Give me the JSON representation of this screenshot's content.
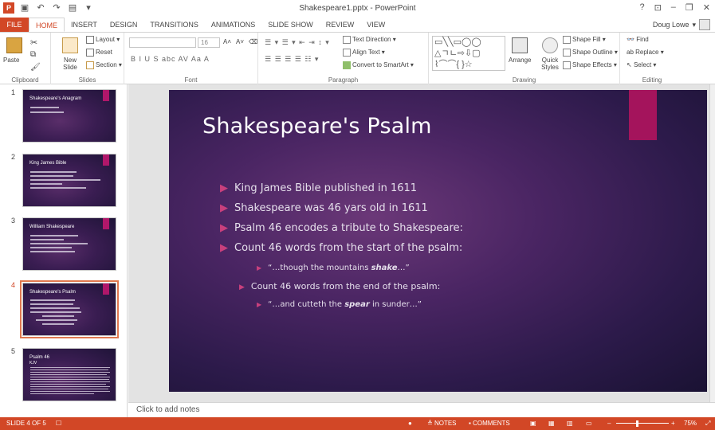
{
  "window": {
    "title": "Shakespeare1.pptx - PowerPoint",
    "help": "?",
    "user": "Doug Lowe"
  },
  "tabs": [
    "FILE",
    "HOME",
    "INSERT",
    "DESIGN",
    "TRANSITIONS",
    "ANIMATIONS",
    "SLIDE SHOW",
    "REVIEW",
    "VIEW"
  ],
  "ribbon": {
    "clipboard": {
      "label": "Clipboard",
      "paste": "Paste"
    },
    "slides": {
      "label": "Slides",
      "new_slide": "New Slide",
      "layout": "Layout",
      "reset": "Reset",
      "section": "Section"
    },
    "font": {
      "label": "Font",
      "size": "16",
      "format_row": "B  I  U  S  abc  AV  Aa  A"
    },
    "paragraph": {
      "label": "Paragraph",
      "text_direction": "Text Direction",
      "align_text": "Align Text",
      "smartart": "Convert to SmartArt"
    },
    "drawing": {
      "label": "Drawing",
      "arrange": "Arrange",
      "quick_styles": "Quick Styles",
      "shape_fill": "Shape Fill",
      "shape_outline": "Shape Outline",
      "shape_effects": "Shape Effects"
    },
    "editing": {
      "label": "Editing",
      "find": "Find",
      "replace": "Replace",
      "select": "Select"
    }
  },
  "thumbnails": [
    {
      "num": "1",
      "title": "Shakespeare's Anagram",
      "lines": 2
    },
    {
      "num": "2",
      "title": "King James Bible",
      "lines": 5
    },
    {
      "num": "3",
      "title": "William Shakespeare",
      "lines": 5
    },
    {
      "num": "4",
      "title": "Shakespeare's Psalm",
      "lines": 7
    },
    {
      "num": "5",
      "title": "Psalm 46",
      "subtitle": "KJV",
      "lines": 12
    }
  ],
  "slide": {
    "title": "Shakespeare's Psalm",
    "bullets": [
      {
        "text": "King James Bible published in 1611"
      },
      {
        "text": "Shakespeare was 46 yars old in 1611"
      },
      {
        "text": "Psalm 46 encodes a tribute to Shakespeare:"
      },
      {
        "text": "Count 46 words from the start of the psalm:"
      },
      {
        "pre": "“…though the mountains ",
        "em": "shake",
        "post": "…”"
      },
      {
        "text": "Count 46 words from the end of the psalm:"
      },
      {
        "pre": "“…and cutteth the ",
        "em": "spear",
        "post": " in sunder…”"
      }
    ]
  },
  "notes_placeholder": "Click to add notes",
  "status": {
    "slide_info": "SLIDE 4 OF 5",
    "notes": "NOTES",
    "comments": "COMMENTS",
    "zoom_level": "75%"
  },
  "colors": {
    "brand": "#d24726",
    "accent_tag": "#a4145c",
    "bullet_arrow": "#c9407d"
  }
}
